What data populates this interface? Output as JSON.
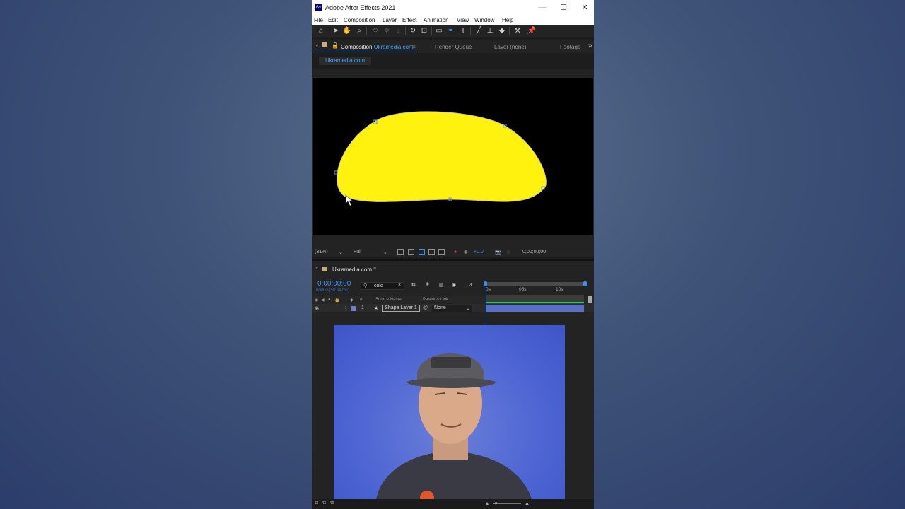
{
  "window": {
    "title": "Adobe After Effects 2021",
    "logo": "Ae",
    "minimize": "—",
    "maximize": "☐",
    "close": "✕"
  },
  "menu": [
    "File",
    "Edit",
    "Composition",
    "Layer",
    "Effect",
    "Animation",
    "View",
    "Window",
    "Help"
  ],
  "tools": [
    "home-icon",
    "selection-tool-icon",
    "hand-tool-icon",
    "zoom-tool-icon",
    "orbit-tool-icon",
    "pan-tool-icon",
    "dolly-tool-icon",
    "rotate-tool-icon",
    "anchor-tool-icon",
    "rectangle-tool-icon",
    "pen-tool-icon",
    "type-tool-icon",
    "brush-tool-icon",
    "clone-stamp-icon",
    "eraser-icon",
    "roto-brush-icon",
    "puppet-pin-icon"
  ],
  "panel": {
    "comp_label": "Composition",
    "comp_name": "Ukramedia.com",
    "render_queue": "Render Queue",
    "layer_tab": "Layer",
    "layer_value": "(none)",
    "footage_tab": "Footage",
    "comp_subtab": "Ukramedia.com"
  },
  "viewer": {
    "zoom": "(31%)",
    "resolution": "Full",
    "exposure": "+0.0",
    "timecode": "0;00;00;00"
  },
  "timeline": {
    "comp_name": "Ukramedia.com",
    "timecode": "0;00;00;00",
    "fps": "00000 (59.94 fps)",
    "search_value": "colo",
    "ruler_labels": [
      "0s",
      "05s",
      "10s"
    ],
    "col_source_name": "Source Name",
    "col_parent": "Parent & Link",
    "col_hash": "#",
    "layers": [
      {
        "index": "1",
        "name": "Shape Layer 1",
        "parent": "None"
      }
    ]
  },
  "colors": {
    "accent": "#3d8cf0",
    "shape_fill": "#fff20e",
    "layer_bar": "#5a6ec9",
    "work_area": "#2ecb4e"
  }
}
